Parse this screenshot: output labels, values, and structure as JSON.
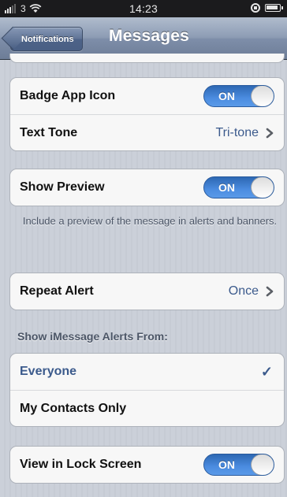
{
  "status_bar": {
    "carrier": "3",
    "time": "14:23"
  },
  "nav": {
    "back_label": "Notifications",
    "title": "Messages"
  },
  "group_badge": {
    "rows": [
      {
        "label": "Badge App Icon",
        "toggle": "ON"
      },
      {
        "label": "Text Tone",
        "value": "Tri-tone"
      }
    ]
  },
  "group_preview": {
    "label": "Show Preview",
    "toggle": "ON",
    "footer": "Include a preview of the message in alerts and banners."
  },
  "group_repeat": {
    "label": "Repeat Alert",
    "value": "Once"
  },
  "imessage_alerts": {
    "header": "Show iMessage Alerts From:",
    "options": [
      {
        "label": "Everyone",
        "checked": true
      },
      {
        "label": "My Contacts Only",
        "checked": false
      }
    ]
  },
  "group_lock": {
    "label": "View in Lock Screen",
    "toggle": "ON"
  },
  "colors": {
    "accent_blue": "#3b5a8c",
    "toggle_blue": "#4b8ce0",
    "nav_bar": "#8d9cb4"
  }
}
